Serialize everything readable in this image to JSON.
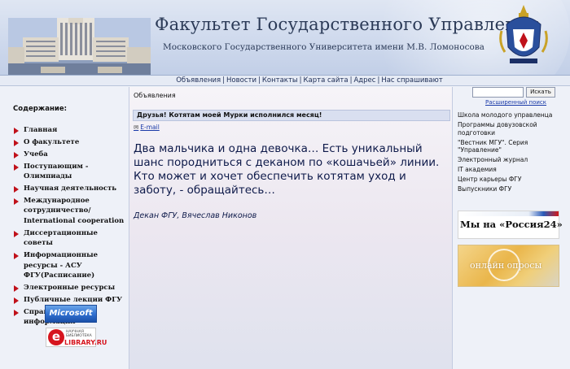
{
  "header": {
    "title": "Факультет Государственного Управления",
    "subtitle": "Московского Государственного Университета имени М.В. Ломоносова"
  },
  "nav": {
    "items": [
      "Объявления",
      "Новости",
      "Контакты",
      "Карта сайта",
      "Адрес",
      "Нас спрашивают"
    ]
  },
  "leftbar": {
    "heading": "Содержание:",
    "items": [
      "Главная",
      "О факультете",
      "Учеба",
      "Поступающим - Олимпиады",
      "Научная деятельность",
      "Международное сотрудничество/ International cooperation",
      "Диссертационные советы",
      "Информационные ресурсы - АСУ ФГУ(Расписание)",
      "Электронные ресурсы",
      "Публичные лекции ФГУ",
      "Справочная информация"
    ],
    "logos": {
      "microsoft": "Microsoft",
      "elibrary_small": "НАУЧНАЯ БИБЛИОТЕКА",
      "elibrary_big": "LIBRARY.RU"
    }
  },
  "main": {
    "section_title": "Объявления",
    "news_headline": "Друзья! Котятам моей Мурки исполнился месяц!",
    "email_label": "E-mail",
    "body": "Два мальчика и одна девочка… Есть уникальный шанс породниться с деканом по «кошачьей» линии. Кто может и хочет обеспечить котятам уход и заботу, - обращайтесь…",
    "signature": "Декан ФГУ, Вячеслав Никонов"
  },
  "rightbar": {
    "search": {
      "value": "",
      "button_label": "Искать",
      "advanced_label": "Расширенный поиск"
    },
    "links": [
      "Школа молодого управленца",
      "Программы довузовской подготовки",
      "\"Вестник МГУ\". Серия \"Управление\"",
      "Электронный журнал",
      "IT академия",
      "Центр карьеры ФГУ",
      "Выпускники ФГУ"
    ],
    "ads": {
      "russia24": "Мы на «Россия24»",
      "polls": "онлайн опросы"
    }
  },
  "colors": {
    "bullet": "#c0111a",
    "link": "#1a3aa8",
    "header_text": "#2b3a57",
    "body_text": "#0e1a4a"
  }
}
